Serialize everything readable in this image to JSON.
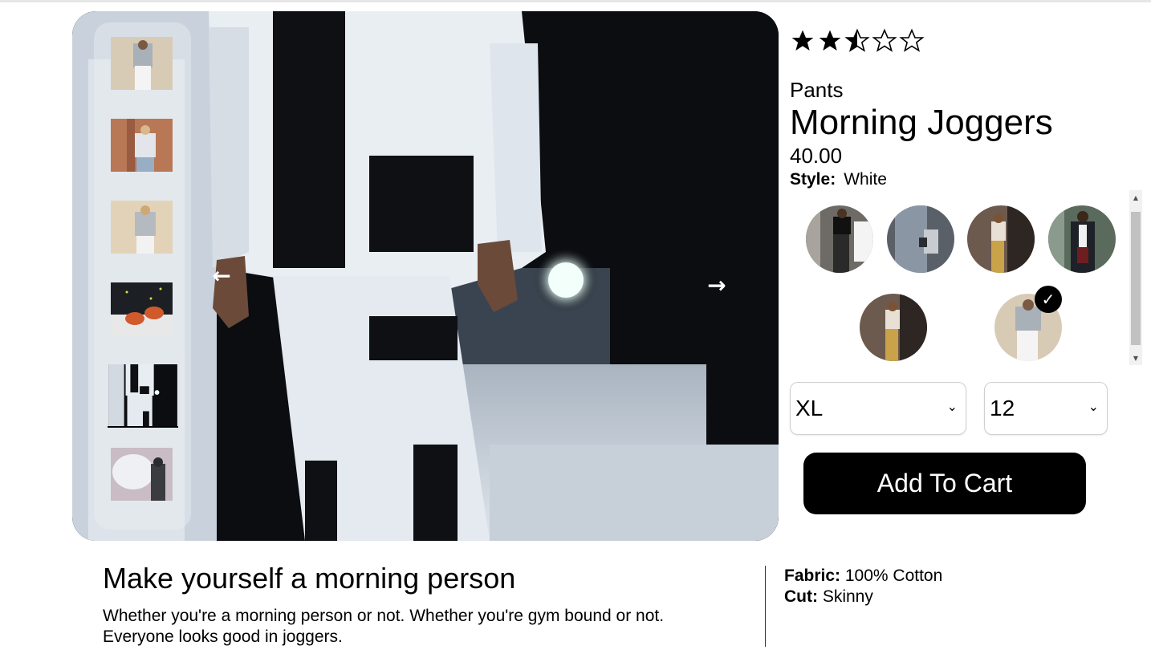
{
  "rating": {
    "value": 2.5,
    "max": 5
  },
  "product": {
    "category": "Pants",
    "name": "Morning Joggers",
    "price": "40.00",
    "style_label": "Style:",
    "selected_style": "White"
  },
  "gallery": {
    "thumbnails": [
      "thumb-1",
      "thumb-2",
      "thumb-3",
      "thumb-4",
      "thumb-5",
      "thumb-6"
    ],
    "active_index": 5,
    "prev_icon": "arrow-left-icon",
    "next_icon": "arrow-right-icon"
  },
  "styles": {
    "swatches": [
      "style-1",
      "style-2",
      "style-3",
      "style-4",
      "style-5",
      "style-6"
    ],
    "selected_index": 6,
    "check_icon": "checkmark-icon"
  },
  "selectors": {
    "size_value": "XL",
    "quantity_value": "12",
    "chevron_icon": "chevron-down-icon"
  },
  "cart": {
    "button_label": "Add To Cart"
  },
  "description": {
    "title": "Make yourself a morning person",
    "body_line1": "Whether you're a morning person or not. Whether you're gym bound or not.",
    "body_line2": "Everyone looks good in joggers."
  },
  "features": [
    {
      "label": "Fabric:",
      "value": "100% Cotton"
    },
    {
      "label": "Cut:",
      "value": "Skinny"
    }
  ],
  "colors": {
    "accent": "#000000",
    "button_text": "#ffffff"
  }
}
